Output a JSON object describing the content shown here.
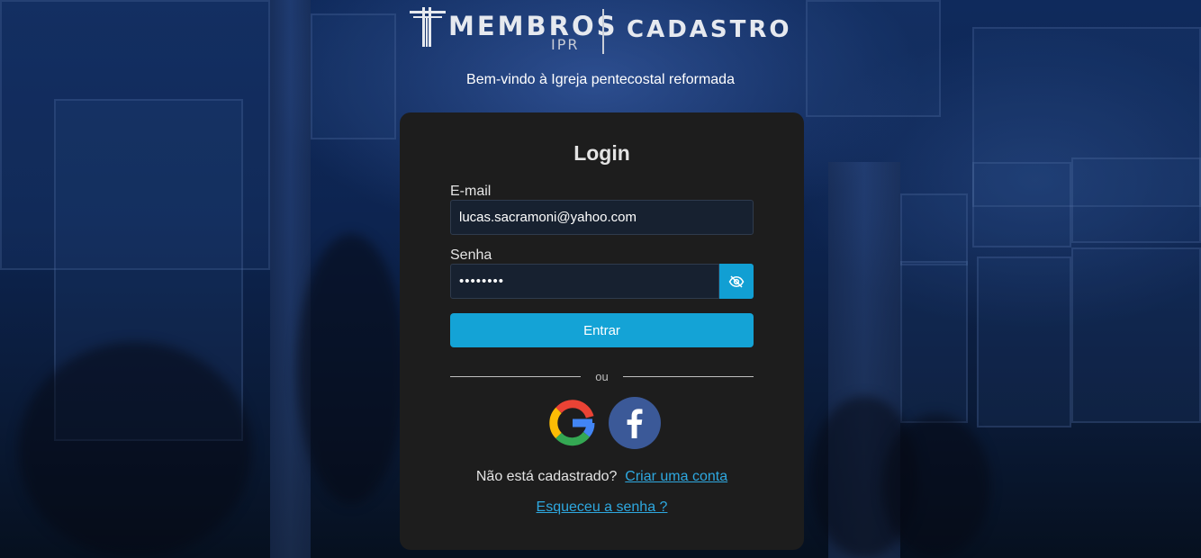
{
  "header": {
    "logo_main": "MEMBROS",
    "logo_sub": "IPR",
    "section_title": "CADASTRO",
    "welcome": "Bem-vindo à Igreja pentecostal reformada"
  },
  "login": {
    "title": "Login",
    "email_label": "E-mail",
    "email_value": "lucas.sacramoni@yahoo.com",
    "password_label": "Senha",
    "password_value": "••••••••",
    "submit_label": "Entrar",
    "separator_text": "ou",
    "signup_prompt": "Não está cadastrado?",
    "signup_link": "Criar uma conta",
    "forgot_link": "Esqueceu a senha ?"
  },
  "icons": {
    "password_toggle": "eye-off-icon",
    "google": "google-icon",
    "facebook": "facebook-icon",
    "logo": "cross-logo-icon"
  },
  "colors": {
    "accent": "#14a3d6",
    "card_bg": "#1d1d1d",
    "link": "#2ea8e0",
    "facebook": "#3b5998"
  }
}
